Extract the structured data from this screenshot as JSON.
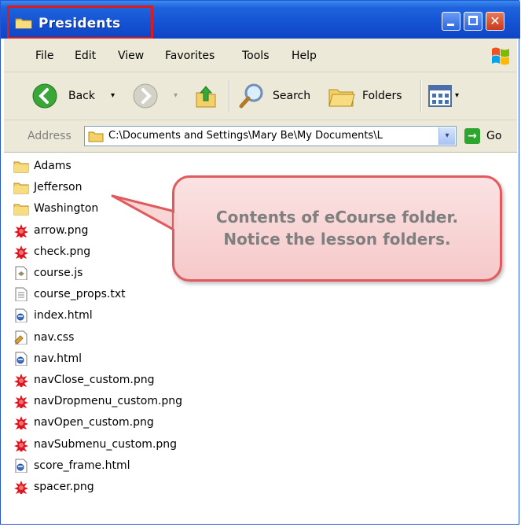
{
  "window": {
    "title": "Presidents",
    "minimize_label": "_",
    "close_label": "✕"
  },
  "menu": {
    "items": [
      "File",
      "Edit",
      "View",
      "Favorites",
      "Tools",
      "Help"
    ]
  },
  "toolbar": {
    "back_label": "Back",
    "search_label": "Search",
    "folders_label": "Folders",
    "dropdown_glyph": "▾"
  },
  "address": {
    "label": "Address",
    "path": "C:\\Documents and Settings\\Mary Be\\My Documents\\L",
    "go_label": "Go",
    "go_glyph": "→"
  },
  "files": [
    {
      "name": "Adams",
      "icon": "folder-icon"
    },
    {
      "name": "Jefferson",
      "icon": "folder-icon"
    },
    {
      "name": "Washington",
      "icon": "folder-icon"
    },
    {
      "name": "arrow.png",
      "icon": "png-image-icon"
    },
    {
      "name": "check.png",
      "icon": "png-image-icon"
    },
    {
      "name": "course.js",
      "icon": "script-file-icon"
    },
    {
      "name": "course_props.txt",
      "icon": "text-file-icon"
    },
    {
      "name": "index.html",
      "icon": "html-file-icon"
    },
    {
      "name": "nav.css",
      "icon": "css-file-icon"
    },
    {
      "name": "nav.html",
      "icon": "html-file-icon"
    },
    {
      "name": "navClose_custom.png",
      "icon": "png-image-icon"
    },
    {
      "name": "navDropmenu_custom.png",
      "icon": "png-image-icon"
    },
    {
      "name": "navOpen_custom.png",
      "icon": "png-image-icon"
    },
    {
      "name": "navSubmenu_custom.png",
      "icon": "png-image-icon"
    },
    {
      "name": "score_frame.html",
      "icon": "html-file-icon"
    },
    {
      "name": "spacer.png",
      "icon": "png-image-icon"
    }
  ],
  "callout": {
    "line1": "Contents of eCourse folder.",
    "line2": "Notice the lesson folders."
  },
  "colors": {
    "titlebar": "#1452d3",
    "highlight": "#e01a1a",
    "callout_fill": "#f6c9ca",
    "callout_border": "#e05a5e",
    "callout_text": "#7f7f7f"
  }
}
